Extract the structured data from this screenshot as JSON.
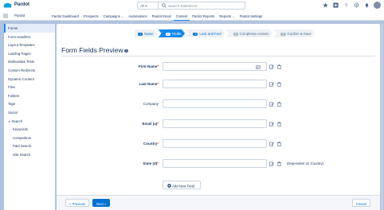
{
  "header": {
    "app_name": "Pardot",
    "scope": "All ▾",
    "search_placeholder": "Search Salesforce",
    "icons": [
      "star-icon",
      "add-icon",
      "help-icon",
      "gear-icon",
      "bell-icon",
      "avatar"
    ]
  },
  "nav": {
    "app_title": "Pardot",
    "tabs": [
      {
        "label": "Pardot Dashboard",
        "caret": false
      },
      {
        "label": "Prospects",
        "caret": false
      },
      {
        "label": "Campaigns",
        "caret": true
      },
      {
        "label": "Automations",
        "caret": false
      },
      {
        "label": "Pardot Email",
        "caret": false
      },
      {
        "label": "Content",
        "caret": false,
        "active": true
      },
      {
        "label": "Pardot Reports",
        "caret": false
      },
      {
        "label": "Reports",
        "caret": true
      },
      {
        "label": "Pardot Settings",
        "caret": false
      }
    ]
  },
  "sidebar": {
    "items": [
      {
        "label": "Forms",
        "active": true
      },
      {
        "label": "Form Handlers"
      },
      {
        "label": "Layout Templates"
      },
      {
        "label": "Landing Pages"
      },
      {
        "label": "Multivariate Tests"
      },
      {
        "label": "Custom Redirects"
      },
      {
        "label": "Dynamic Content"
      },
      {
        "label": "Files"
      },
      {
        "label": "Folders"
      },
      {
        "label": "Tags"
      },
      {
        "label": "Social"
      },
      {
        "label": "Search",
        "expandable": true
      },
      {
        "label": "Keywords",
        "sub": true
      },
      {
        "label": "Competitors",
        "sub": true
      },
      {
        "label": "Paid Search",
        "sub": true
      },
      {
        "label": "Site Search",
        "sub": true
      }
    ]
  },
  "wizard": {
    "steps": [
      {
        "num": "1",
        "label": "Name",
        "state": "done"
      },
      {
        "num": "2",
        "label": "Fields",
        "state": "current"
      },
      {
        "num": "3",
        "label": "Look and Feel",
        "state": "done"
      },
      {
        "num": "4",
        "label": "Completion Actions",
        "state": "todo"
      },
      {
        "num": "5",
        "label": "Confirm & Save",
        "state": "todo"
      }
    ]
  },
  "form": {
    "title": "Form Fields Preview",
    "fields": [
      {
        "label": "First Name",
        "required": true,
        "bold": true,
        "has_input_icon": true
      },
      {
        "label": "Last Name",
        "required": true,
        "bold": true
      },
      {
        "label": "Company",
        "required": false,
        "bold": false
      },
      {
        "label": "Email (a)",
        "required": true,
        "bold": true
      },
      {
        "label": "Country",
        "required": true,
        "bold": true
      },
      {
        "label": "State (d)",
        "required": true,
        "bold": true,
        "note": "(Dependent on Country)"
      }
    ],
    "add_field_label": "Add New Field"
  },
  "footer": {
    "previous_label": "« Previous",
    "next_label": "Next »",
    "cancel_label": "Cancel"
  }
}
